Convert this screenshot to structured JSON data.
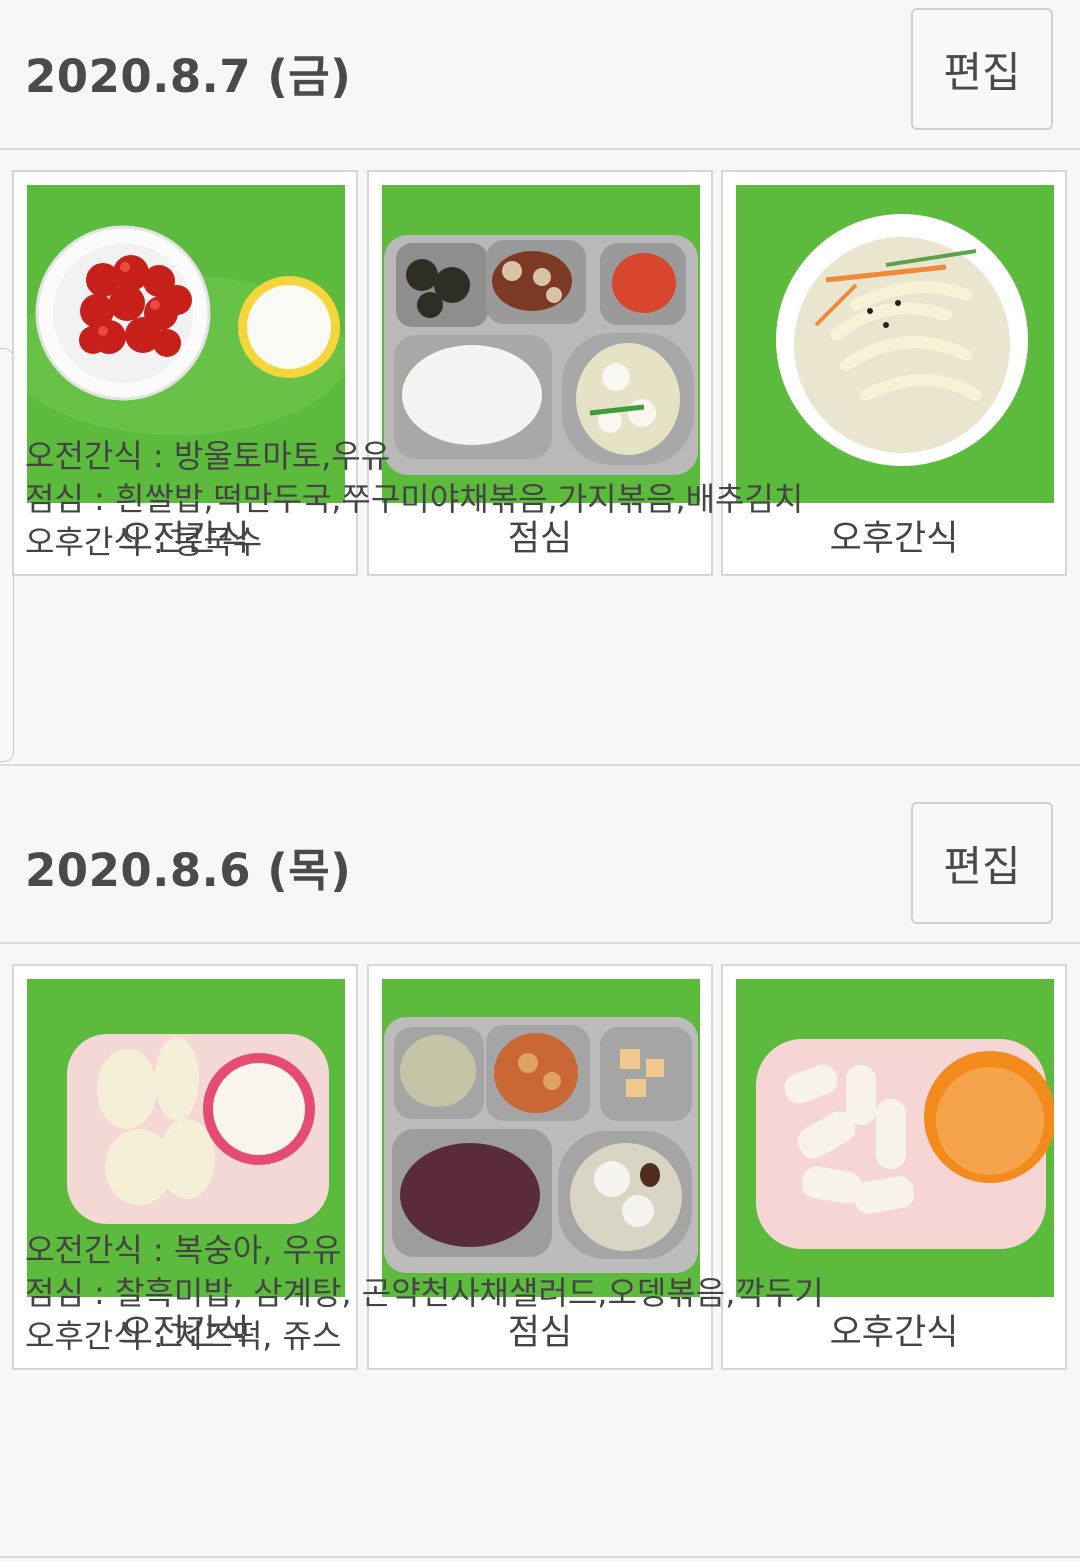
{
  "days": [
    {
      "title": "2020.8.7 (금)",
      "edit_label": "편집",
      "meals": [
        {
          "label": "오전간식"
        },
        {
          "label": "점심"
        },
        {
          "label": "오후간식"
        }
      ],
      "menu": [
        "오전간식 : 방울토마토,우유",
        "점심 : 흰쌀밥,떡만두국,쭈구미야채볶음,가지볶음,배추김치",
        "오후간식 : 콩국수"
      ]
    },
    {
      "title": "2020.8.6 (목)",
      "edit_label": "편집",
      "meals": [
        {
          "label": "오전간식"
        },
        {
          "label": "점심"
        },
        {
          "label": "오후간식"
        }
      ],
      "menu": [
        "오전간식 : 복숭아, 우유",
        "점심 : 찰흑미밥, 삼계탕, 곤약천사채샐러드,오뎅볶음,깍두기",
        "오후간식 : 치즈떡, 쥬스"
      ]
    }
  ],
  "colors": {
    "background": "#f7f7f7",
    "tray_green": "#5bbf3e",
    "border": "#d6d6d6"
  }
}
